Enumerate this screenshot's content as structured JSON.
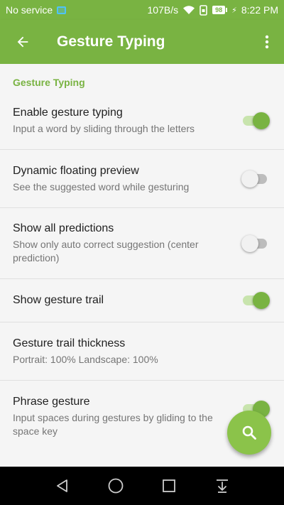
{
  "status_bar": {
    "carrier": "No service",
    "network_speed": "107B/s",
    "battery": "98",
    "time": "8:22 PM",
    "icons": [
      "sim-icon",
      "wifi-icon",
      "phone-lock-icon",
      "battery-icon",
      "charging-icon"
    ]
  },
  "app_bar": {
    "title": "Gesture Typing",
    "back_icon": "arrow-back-icon",
    "more_icon": "more-vert-icon"
  },
  "section": {
    "header": "Gesture Typing"
  },
  "settings": [
    {
      "title": "Enable gesture typing",
      "summary": "Input a word by sliding through the letters",
      "switch_on": true
    },
    {
      "title": "Dynamic floating preview",
      "summary": "See the suggested word while gesturing",
      "switch_on": false
    },
    {
      "title": "Show all predictions",
      "summary": "Show only auto correct suggestion (center prediction)",
      "switch_on": false
    },
    {
      "title": "Show gesture trail",
      "switch_on": true
    },
    {
      "title": "Gesture trail thickness",
      "summary": "Portrait: 100% Landscape: 100%"
    },
    {
      "title": "Phrase gesture",
      "summary": "Input spaces during gestures by gliding to the space key",
      "switch_on": true
    }
  ],
  "fab": {
    "icon": "search-icon"
  },
  "nav_bar": {
    "icons": [
      "nav-back-icon",
      "nav-home-icon",
      "nav-recents-icon",
      "nav-notification-icon"
    ]
  },
  "colors": {
    "primary": "#79b342",
    "accent": "#8bc34a",
    "switch_track_on": "#c8e4ad",
    "switch_off": "#f1f1f1",
    "background": "#f5f5f5",
    "divider": "#e0e0e0"
  }
}
